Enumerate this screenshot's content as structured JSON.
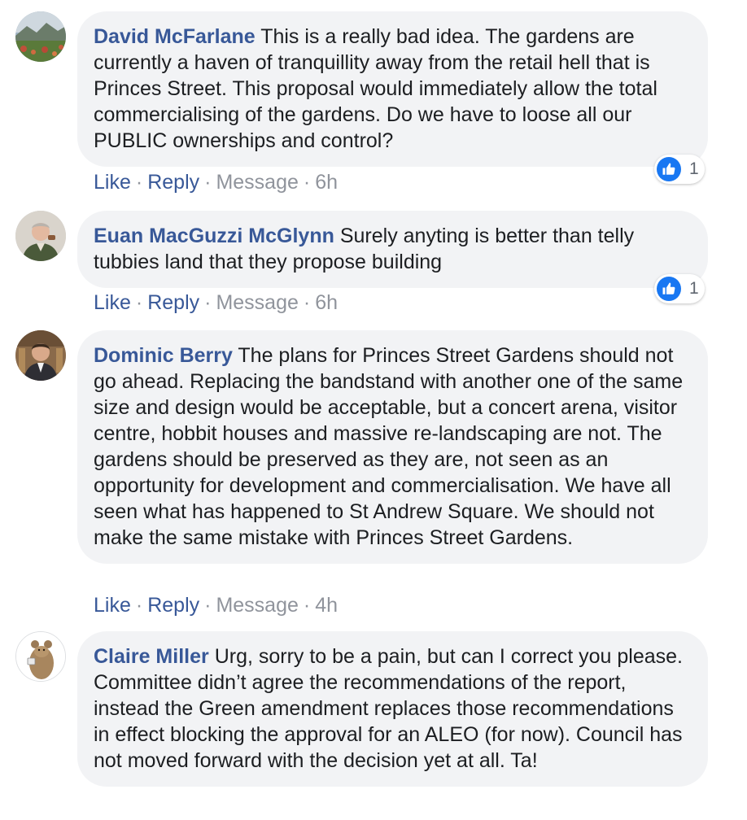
{
  "comments": [
    {
      "author": "David McFarlane",
      "text": "This is a really bad idea. The gardens are currently a haven of tranquillity away from the retail hell that is Princes Street. This proposal would immediately allow the total commercialising of the gardens. Do we have to loose all our PUBLIC ownerships and control?",
      "like_label": "Like",
      "reply_label": "Reply",
      "message_label": "Message",
      "time": "6h",
      "reaction_count": "1"
    },
    {
      "author": "Euan MacGuzzi McGlynn",
      "text": "Surely anyting is better than telly tubbies land that they propose building",
      "like_label": "Like",
      "reply_label": "Reply",
      "message_label": "Message",
      "time": "6h",
      "reaction_count": "1"
    },
    {
      "author": "Dominic Berry",
      "text": "The plans for Princes Street Gardens should not go ahead. Replacing the bandstand with another one of the same size and design would be acceptable, but a concert arena, visitor centre, hobbit houses and massive re-landscaping are not. The gardens should be preserved as they are, not seen as an opportunity for development and commercialisation. We have all seen what has happened to St Andrew Square. We should not make the same mistake with Princes Street Gardens.",
      "like_label": "Like",
      "reply_label": "Reply",
      "message_label": "Message",
      "time": "4h"
    },
    {
      "author": "Claire Miller",
      "text": "Urg, sorry to be a pain, but can I correct you please. Committee didn’t agree the recommendations of the report, instead the Green amendment replaces those recommendations in effect blocking the approval for an ALEO (for now). Council has not moved forward with the decision yet at all. Ta!"
    }
  ],
  "colors": {
    "author_link": "#385898",
    "bubble_bg": "#f2f3f5",
    "text": "#1c1e21",
    "meta": "#90949c",
    "like_blue": "#1877f2"
  },
  "icons": {
    "reaction": "thumbs-up-icon"
  }
}
